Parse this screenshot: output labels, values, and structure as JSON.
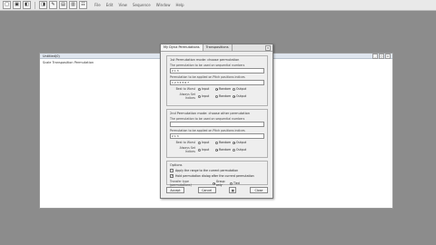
{
  "toolbar": {
    "buttons": [
      "□",
      "▣",
      "◧",
      "◨",
      "✎",
      "▤",
      "▥",
      "☷"
    ],
    "menu": [
      "File",
      "Edit",
      "View",
      "Sequence",
      "Window",
      "Help"
    ]
  },
  "background_window": {
    "title": "Untitled(0)",
    "line": "Scale Transposition Permutation"
  },
  "dialog": {
    "tabs": [
      "My Dyna Permutations",
      "Transpositions"
    ],
    "close": "✕",
    "group1": {
      "title": "1st Permutation mode: choose permutation",
      "label1": "The permutation to be used on sequential numbers",
      "value1": "2 1 3",
      "label2": "Permutation to be applied on Pitch positions indices",
      "value2": "1 2 3 4 5 6 7",
      "row1": {
        "label": "Best to Worst",
        "options": [
          "Input",
          "Random",
          "Output"
        ],
        "selected": 1
      },
      "row2": {
        "label": "Always Set Indices",
        "options": [
          "Input",
          "Random",
          "Output"
        ],
        "selected": 2
      }
    },
    "group2": {
      "title": "2nd Permutation mode: choose other permutation",
      "label1": "The permutation to be used on sequential numbers",
      "value1": "",
      "label2": "Permutation to be applied on Pitch positions indices",
      "value2": "2 1 3",
      "row1": {
        "label": "Best to Worst",
        "options": [
          "Input",
          "Random",
          "Output"
        ],
        "selected": 2
      },
      "row2": {
        "label": "Always Set Indices",
        "options": [
          "Input",
          "Random",
          "Output"
        ],
        "selected": 1
      }
    },
    "group3": {
      "title": "Options",
      "check1": {
        "label": "Apply the range to the current permutation",
        "checked": false
      },
      "check2": {
        "label": "Hold permutation dialog after the current permutation",
        "checked": true
      },
      "direction_label": "Transfer type (permutations)",
      "direction_options": [
        "Group only",
        "Tied"
      ],
      "direction_selected": 0
    },
    "buttons": {
      "accept": "Accept",
      "cancel": "Cancel",
      "close": "Close"
    }
  }
}
